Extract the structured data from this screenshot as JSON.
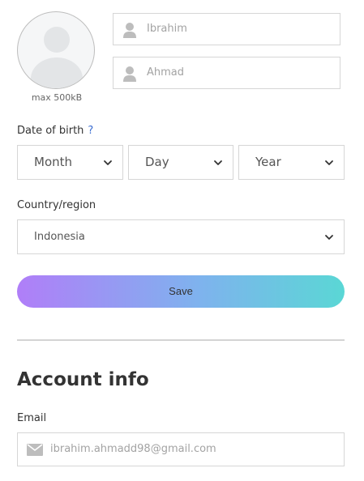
{
  "profile": {
    "avatar_caption": "max 500kB",
    "first_name": "Ibrahim",
    "last_name": "Ahmad"
  },
  "birth": {
    "label": "Date of birth",
    "help": "?",
    "month": "Month",
    "day": "Day",
    "year": "Year"
  },
  "country": {
    "label": "Country/region",
    "value": "Indonesia"
  },
  "save_label": "Save",
  "account": {
    "title": "Account info",
    "email_label": "Email",
    "email_value": "ibrahim.ahmadd98@gmail.com"
  },
  "colors": {
    "gradient_start": "#b07ef8",
    "gradient_end": "#5ad7d5",
    "help": "#3d6fd1"
  },
  "icons": {
    "avatar": "avatar-placeholder-icon",
    "user": "user-icon",
    "chevron": "chevron-down-icon",
    "mail": "envelope-icon"
  }
}
